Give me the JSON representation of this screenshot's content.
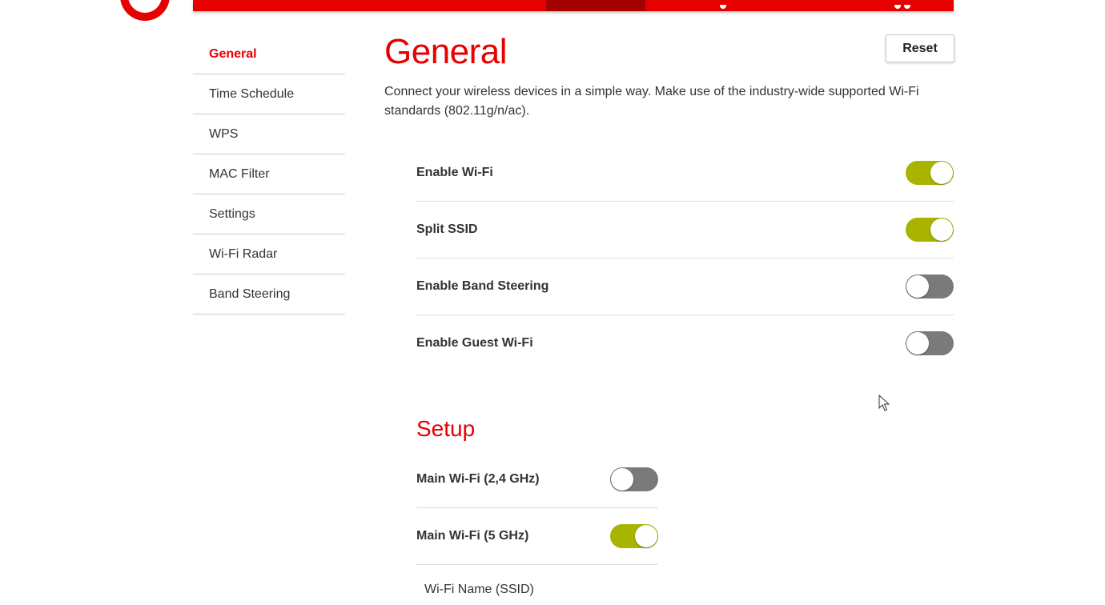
{
  "brand": {
    "accent": "#e60000",
    "active_tab": "#a50000",
    "toggle_on": "#a8b400",
    "toggle_off": "#7a7a7a"
  },
  "topbar": {
    "logo_icon": "speech-mark-logo"
  },
  "sidebar": {
    "items": [
      {
        "label": "General",
        "active": true
      },
      {
        "label": "Time Schedule"
      },
      {
        "label": "WPS"
      },
      {
        "label": "MAC Filter"
      },
      {
        "label": "Settings"
      },
      {
        "label": "Wi-Fi Radar"
      },
      {
        "label": "Band Steering"
      }
    ]
  },
  "main": {
    "title": "General",
    "reset_label": "Reset",
    "description": "Connect your wireless devices in a simple way. Make use of the industry-wide supported Wi-Fi standards (802.11g/n/ac).",
    "toggles": [
      {
        "label": "Enable Wi-Fi",
        "on": true
      },
      {
        "label": "Split SSID",
        "on": true
      },
      {
        "label": "Enable Band Steering",
        "on": false
      },
      {
        "label": "Enable Guest Wi-Fi",
        "on": false
      }
    ]
  },
  "setup": {
    "title": "Setup",
    "toggles": [
      {
        "label": "Main Wi-Fi (2,4 GHz)",
        "on": false
      },
      {
        "label": "Main Wi-Fi (5 GHz)",
        "on": true
      }
    ],
    "ssid_label": "Wi-Fi Name (SSID)"
  }
}
